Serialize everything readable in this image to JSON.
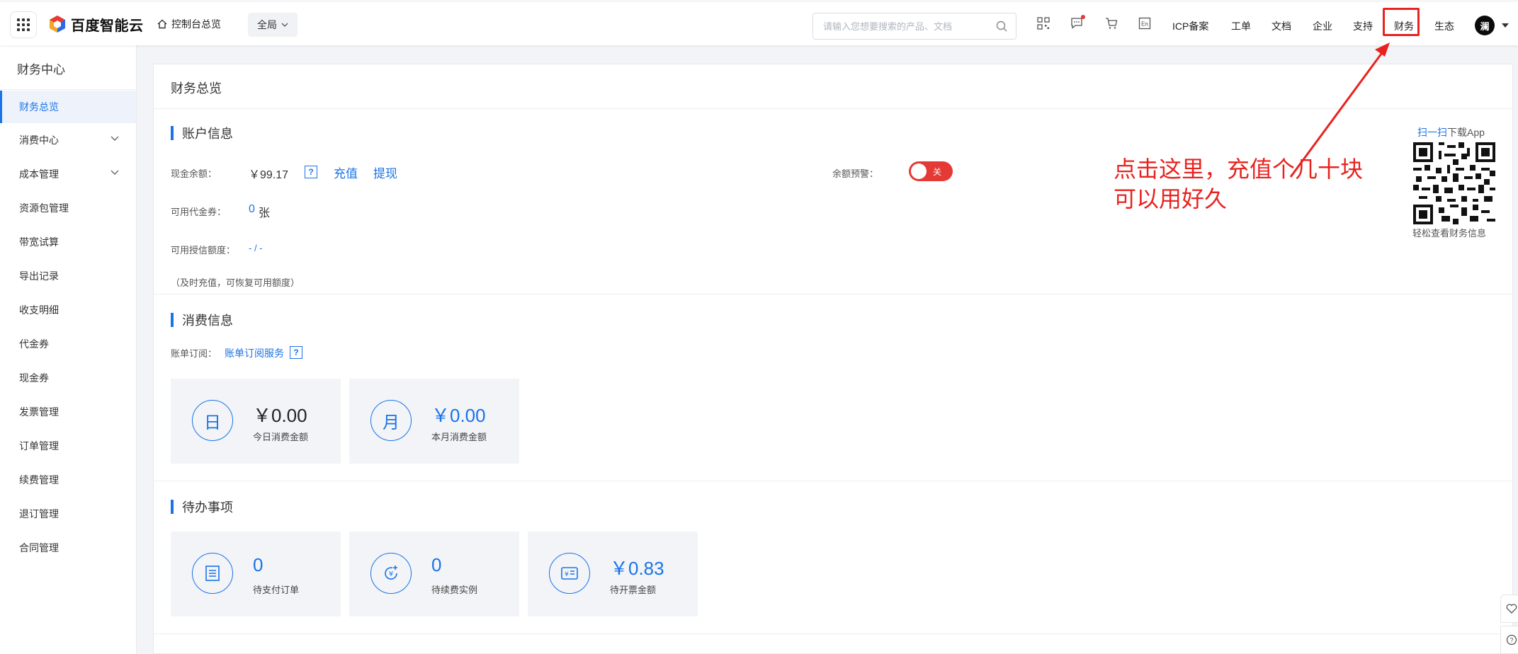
{
  "header": {
    "logo_text": "百度智能云",
    "console_link": "控制台总览",
    "scope_label": "全局",
    "search_placeholder": "请输入您想要搜索的产品、文档",
    "nav": [
      "ICP备案",
      "工单",
      "文档",
      "企业",
      "支持",
      "财务",
      "生态"
    ],
    "active_nav": "财务",
    "avatar_initial": "澜"
  },
  "sidebar": {
    "title": "财务中心",
    "items": [
      {
        "label": "财务总览",
        "active": true
      },
      {
        "label": "消费中心",
        "expandable": true
      },
      {
        "label": "成本管理",
        "expandable": true
      },
      {
        "label": "资源包管理"
      },
      {
        "label": "带宽试算"
      },
      {
        "label": "导出记录"
      },
      {
        "label": "收支明细"
      },
      {
        "label": "代金券"
      },
      {
        "label": "现金券"
      },
      {
        "label": "发票管理"
      },
      {
        "label": "订单管理"
      },
      {
        "label": "续费管理"
      },
      {
        "label": "退订管理"
      },
      {
        "label": "合同管理"
      }
    ]
  },
  "main": {
    "page_title": "财务总览",
    "account": {
      "heading": "账户信息",
      "cash_label": "现金余额：",
      "cash_value": "￥99.17",
      "help_mark": "?",
      "recharge": "充值",
      "withdraw": "提现",
      "alert_label": "余额预警：",
      "alert_toggle": "关",
      "voucher_label": "可用代金券：",
      "voucher_count": "0",
      "voucher_unit": "张",
      "credit_label": "可用授信额度：",
      "credit_value": "- / -",
      "credit_note": "（及时充值，可恢复可用额度）",
      "qr_prefix": "扫一扫",
      "qr_suffix": "下载App",
      "qr_caption": "轻松查看财务信息"
    },
    "annotation": [
      "点击这里，充值个几十块",
      "可以用好久"
    ],
    "consumption": {
      "heading": "消费信息",
      "subscribe_label": "账单订阅：",
      "subscribe_link": "账单订阅服务",
      "cards": [
        {
          "icon_char": "日",
          "amount": "￥0.00",
          "label": "今日消费金额"
        },
        {
          "icon_char": "月",
          "amount": "￥0.00",
          "label": "本月消费金额"
        }
      ]
    },
    "todo": {
      "heading": "待办事项",
      "cards": [
        {
          "amount": "0",
          "label": "待支付订单"
        },
        {
          "amount": "0",
          "label": "待续费实例"
        },
        {
          "amount": "￥0.83",
          "label": "待开票金额"
        }
      ]
    }
  },
  "colors": {
    "accent": "#1a73e8",
    "annotation_red": "#e8231f",
    "toggle_off": "#e53935"
  }
}
